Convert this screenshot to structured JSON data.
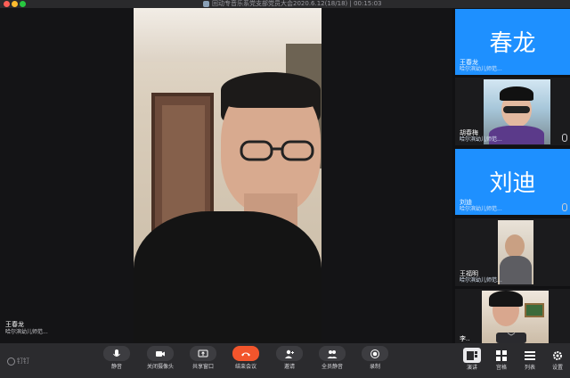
{
  "window": {
    "title": "回动专音乐系党支部党员大会2020.6.12(18/18) | 00:15:03"
  },
  "main_video": {
    "name": "王春龙",
    "subtitle": "哈尔滨幼儿师范..."
  },
  "participants": [
    {
      "display": "avatar",
      "avatar_text": "春龙",
      "name": "王春龙",
      "subtitle": "哈尔滨幼儿师范...",
      "avatar_color": "#1e90ff",
      "muted": false
    },
    {
      "display": "video",
      "name": "胡春梅",
      "subtitle": "哈尔滨幼儿师范...",
      "muted": true
    },
    {
      "display": "avatar",
      "avatar_text": "刘迪",
      "name": "刘迪",
      "subtitle": "哈尔滨幼儿师范...",
      "avatar_color": "#1e90ff",
      "muted": true
    },
    {
      "display": "video",
      "name": "王福明",
      "subtitle": "哈尔滨幼儿师范...",
      "muted": false
    },
    {
      "display": "video",
      "name": "李..",
      "subtitle": "",
      "muted": false
    }
  ],
  "sidebar": {
    "scroll_up_icon": "chevron-up-icon",
    "scroll_down_icon": "chevron-down-icon"
  },
  "toolbar": {
    "brand": "钉钉",
    "buttons": [
      {
        "label": "静音",
        "icon": "microphone-icon"
      },
      {
        "label": "关闭摄像头",
        "icon": "camera-icon"
      },
      {
        "label": "共享窗口",
        "icon": "screen-share-icon"
      },
      {
        "label": "结束会议",
        "icon": "phone-hangup-icon",
        "color": "#f2552c"
      },
      {
        "label": "邀请",
        "icon": "invite-user-icon"
      },
      {
        "label": "全员静音",
        "icon": "mute-all-icon"
      },
      {
        "label": "录制",
        "icon": "record-icon"
      }
    ],
    "view_buttons": [
      {
        "label": "演讲",
        "icon": "speaker-view-icon",
        "active": true
      },
      {
        "label": "宫格",
        "icon": "grid-view-icon",
        "active": false
      },
      {
        "label": "列表",
        "icon": "list-view-icon",
        "active": false
      }
    ],
    "settings_label": "设置"
  }
}
